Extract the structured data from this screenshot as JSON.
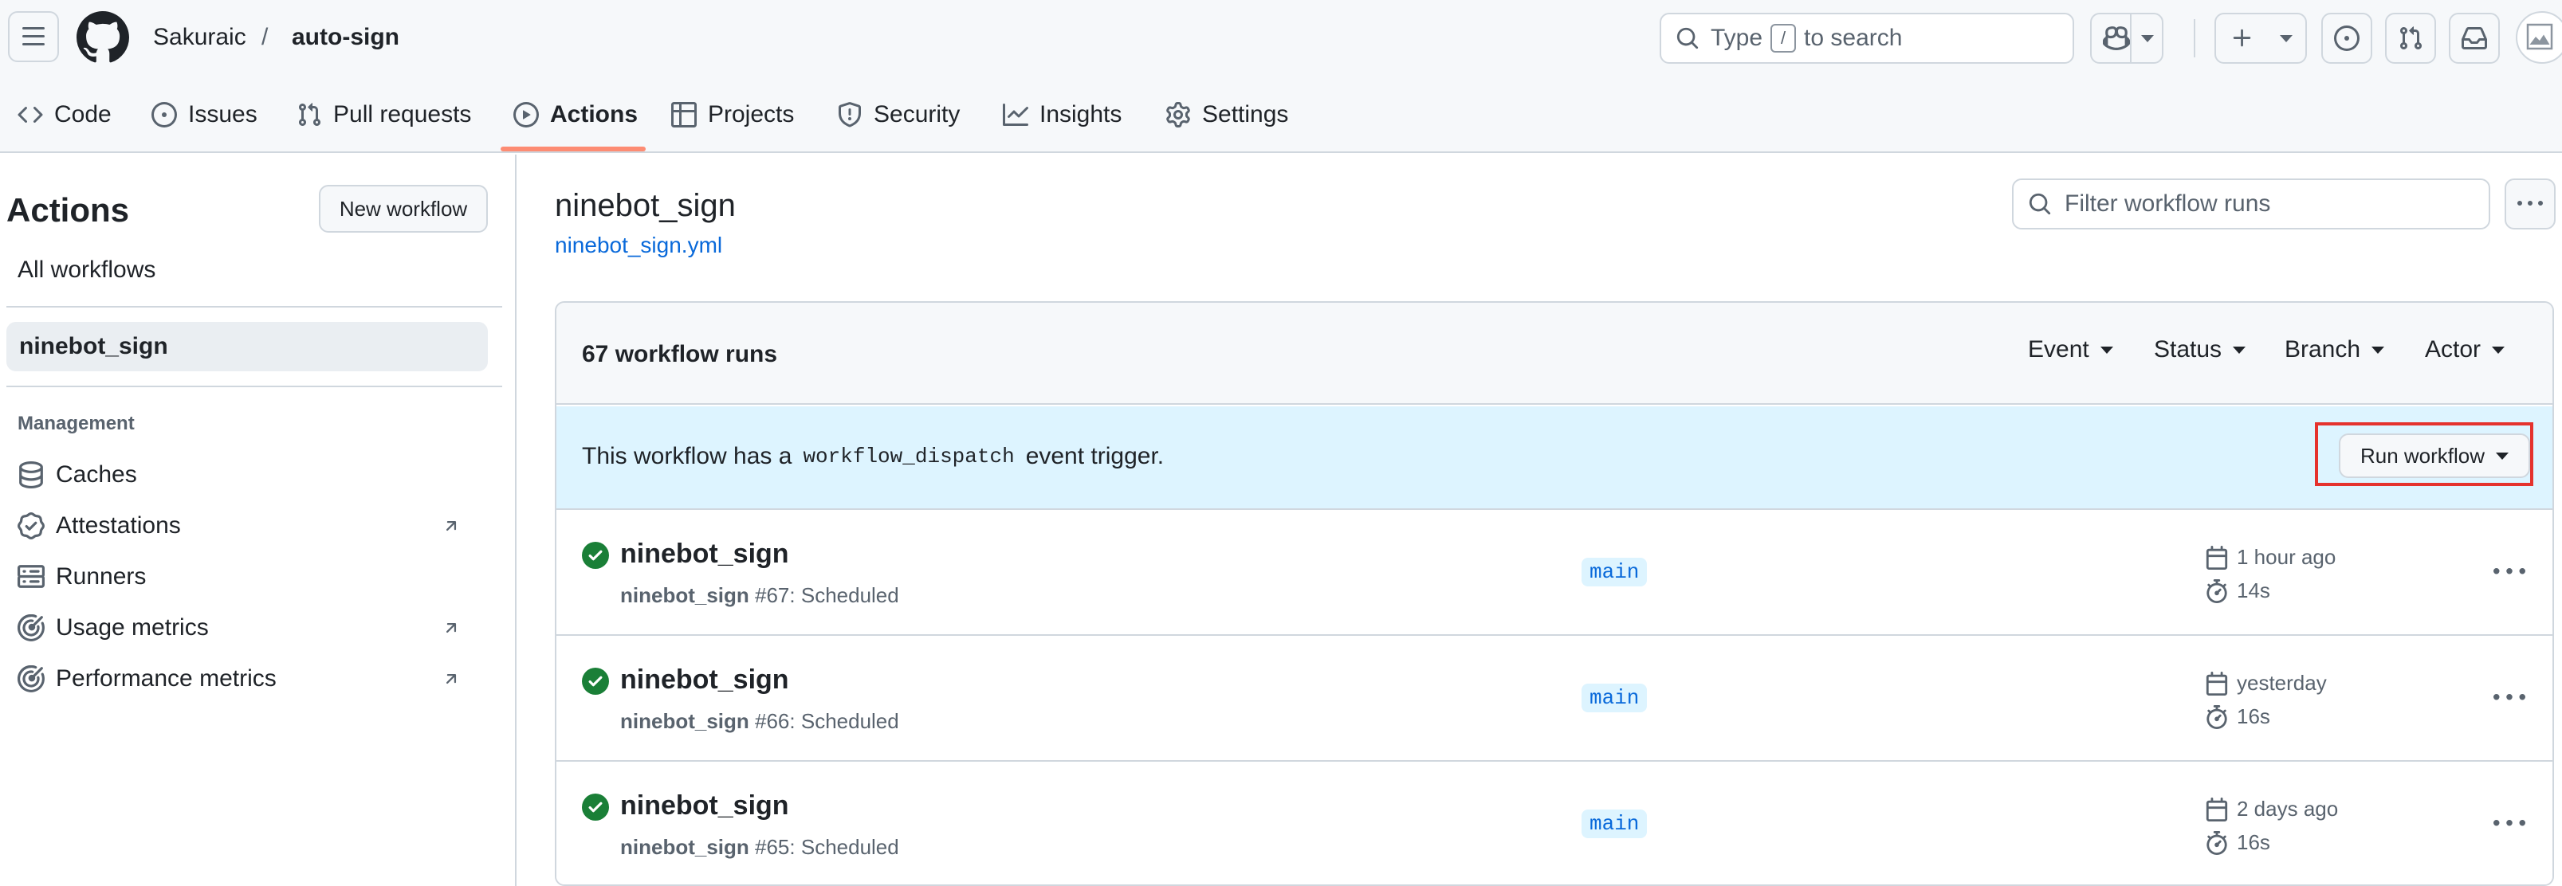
{
  "header": {
    "owner": "Sakuraic",
    "separator": "/",
    "repo": "auto-sign",
    "search": {
      "prefix": "Type",
      "key": "/",
      "suffix": "to search"
    }
  },
  "tabs": [
    {
      "label": "Code",
      "icon": "code-icon"
    },
    {
      "label": "Issues",
      "icon": "issue-opened-icon"
    },
    {
      "label": "Pull requests",
      "icon": "git-pull-request-icon"
    },
    {
      "label": "Actions",
      "icon": "play-icon",
      "selected": true
    },
    {
      "label": "Projects",
      "icon": "table-icon"
    },
    {
      "label": "Security",
      "icon": "shield-icon"
    },
    {
      "label": "Insights",
      "icon": "graph-icon"
    },
    {
      "label": "Settings",
      "icon": "gear-icon"
    }
  ],
  "sidebar": {
    "title": "Actions",
    "new_workflow": "New workflow",
    "all_workflows": "All workflows",
    "selected_workflow": "ninebot_sign",
    "management_heading": "Management",
    "management": [
      {
        "label": "Caches",
        "icon": "database-icon"
      },
      {
        "label": "Attestations",
        "icon": "verified-icon",
        "external": true
      },
      {
        "label": "Runners",
        "icon": "server-icon"
      },
      {
        "label": "Usage metrics",
        "icon": "meter-icon",
        "external": true
      },
      {
        "label": "Performance metrics",
        "icon": "meter-icon",
        "external": true
      }
    ]
  },
  "main": {
    "workflow_name": "ninebot_sign",
    "workflow_file": "ninebot_sign.yml",
    "filter_placeholder": "Filter workflow runs",
    "runs_count": "67 workflow runs",
    "filters": [
      "Event",
      "Status",
      "Branch",
      "Actor"
    ],
    "banner": {
      "text_before": "This workflow has a",
      "code": "workflow_dispatch",
      "text_after": "event trigger.",
      "button": "Run workflow"
    },
    "runs": [
      {
        "title": "ninebot_sign",
        "workflow": "ninebot_sign",
        "number": "#67",
        "event": ": Scheduled",
        "branch": "main",
        "when": "1 hour ago",
        "duration": "14s",
        "status": "success"
      },
      {
        "title": "ninebot_sign",
        "workflow": "ninebot_sign",
        "number": "#66",
        "event": ": Scheduled",
        "branch": "main",
        "when": "yesterday",
        "duration": "16s",
        "status": "success"
      },
      {
        "title": "ninebot_sign",
        "workflow": "ninebot_sign",
        "number": "#65",
        "event": ": Scheduled",
        "branch": "main",
        "when": "2 days ago",
        "duration": "16s",
        "status": "success"
      }
    ]
  },
  "colors": {
    "accent_link": "#0969da",
    "success": "#1a7f37",
    "tab_underline": "#fd8c73",
    "banner_bg": "#ddf4ff",
    "highlight_box": "#e5322d"
  }
}
